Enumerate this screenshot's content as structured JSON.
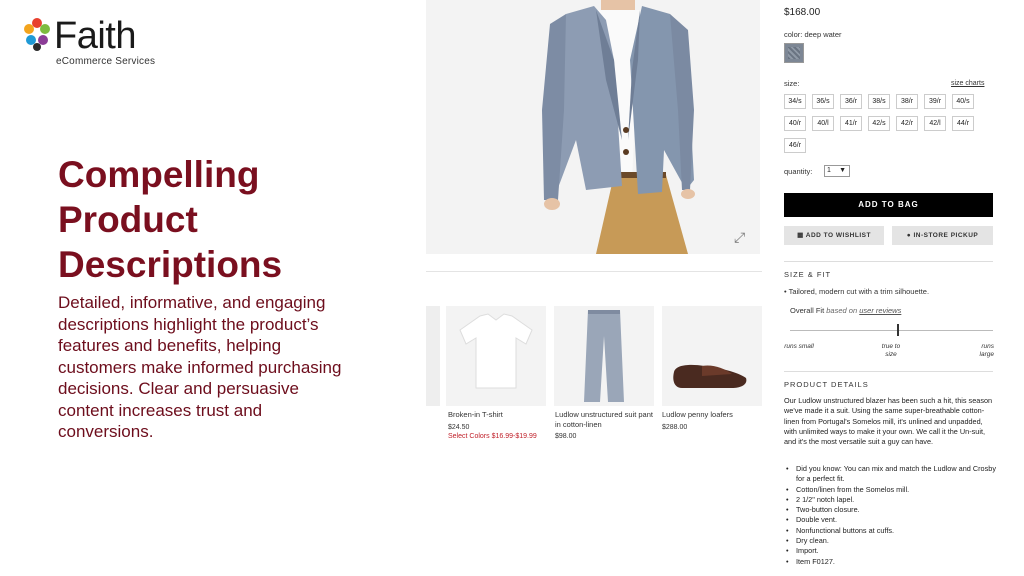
{
  "brand": {
    "name": "Faith",
    "tagline": "eCommerce Services",
    "colors": [
      "#e8402e",
      "#f3a41d",
      "#7dbb3f",
      "#1f9ad6",
      "#8c3d97"
    ]
  },
  "slide": {
    "headline": "Compelling Product Descriptions",
    "body": "Detailed, informative, and engaging descriptions highlight the product’s features and benefits, helping customers make informed purchasing decisions. Clear and persuasive content increases trust and conversions.",
    "accent": "#7a0f1f"
  },
  "product": {
    "price": "$168.00",
    "color_label": "color:",
    "color_value": "deep water",
    "size_label": "size:",
    "size_charts": "size charts",
    "sizes": [
      "34/s",
      "36/s",
      "36/r",
      "38/s",
      "38/r",
      "39/r",
      "40/s",
      "40/r",
      "40/l",
      "41/r",
      "42/s",
      "42/r",
      "42/l",
      "44/r",
      "46/r"
    ],
    "quantity_label": "quantity:",
    "quantity_value": "1",
    "add_to_bag": "ADD TO BAG",
    "add_to_wishlist": "ADD TO WISHLIST",
    "in_store_pickup": "IN-STORE PICKUP",
    "size_fit_title": "SIZE & FIT",
    "fit_note": "Tailored, modern cut with a trim silhouette.",
    "overall_fit": "Overall Fit",
    "based_on": "based on",
    "user_reviews": "user reviews",
    "fit_labels": {
      "left": "runs small",
      "center": "true to size",
      "right": "runs large"
    },
    "details_title": "PRODUCT DETAILS",
    "details": "Our Ludlow unstructured blazer has been such a hit, this season we've made it a suit. Using the same super-breathable cotton-linen from Portugal's Somelos mill, it's unlined and unpadded, with unlimited ways to make it your own. We call it the Un-suit, and it's the most versatile suit a guy can have.",
    "bullets": [
      "Did you know: You can mix and match the Ludlow and Crosby for a perfect fit.",
      "Cotton/linen from the Somelos mill.",
      "2 1/2\" notch lapel.",
      "Two-button closure.",
      "Double vent.",
      "Nonfunctional buttons at cuffs.",
      "Dry clean.",
      "Import.",
      "Item F0127."
    ]
  },
  "recommendations": [
    {
      "name": "Broken-in T-shirt",
      "price": "$24.50",
      "sale": "Select Colors $16.99-$19.99"
    },
    {
      "name": "Ludlow unstructured suit pant in cotton-linen",
      "price": "$98.00",
      "sale": ""
    },
    {
      "name": "Ludlow penny loafers",
      "price": "$288.00",
      "sale": ""
    }
  ]
}
